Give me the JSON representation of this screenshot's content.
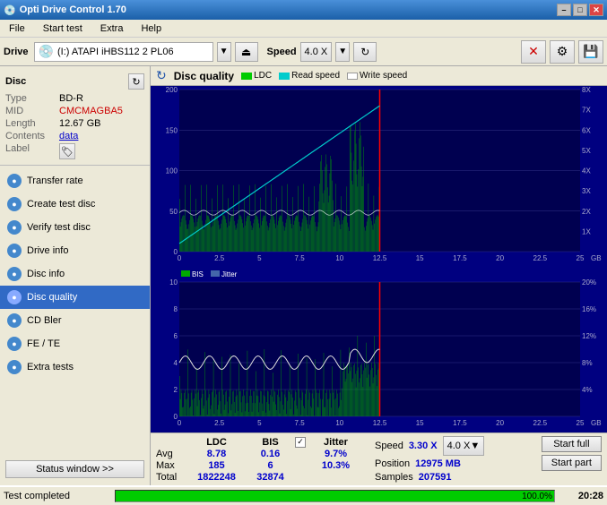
{
  "titlebar": {
    "title": "Opti Drive Control 1.70",
    "icon": "💿",
    "minimize": "–",
    "maximize": "□",
    "close": "✕"
  },
  "menubar": {
    "items": [
      "File",
      "Start test",
      "Extra",
      "Help"
    ]
  },
  "toolbar": {
    "drive_label": "Drive",
    "drive_icon": "💿",
    "drive_value": "(I:)  ATAPI iHBS112  2 PL06",
    "speed_label": "Speed",
    "speed_value": "4.0 X"
  },
  "disc": {
    "title": "Disc",
    "type_label": "Type",
    "type_value": "BD-R",
    "mid_label": "MID",
    "mid_value": "CMCMAGBA5",
    "length_label": "Length",
    "length_value": "12.67 GB",
    "contents_label": "Contents",
    "contents_value": "data",
    "label_label": "Label"
  },
  "sidebar_nav": [
    {
      "id": "transfer-rate",
      "label": "Transfer rate",
      "active": false
    },
    {
      "id": "create-test-disc",
      "label": "Create test disc",
      "active": false
    },
    {
      "id": "verify-test-disc",
      "label": "Verify test disc",
      "active": false
    },
    {
      "id": "drive-info",
      "label": "Drive info",
      "active": false
    },
    {
      "id": "disc-info",
      "label": "Disc info",
      "active": false
    },
    {
      "id": "disc-quality",
      "label": "Disc quality",
      "active": true
    },
    {
      "id": "cd-bler",
      "label": "CD Bler",
      "active": false
    },
    {
      "id": "fe-te",
      "label": "FE / TE",
      "active": false
    },
    {
      "id": "extra-tests",
      "label": "Extra tests",
      "active": false
    }
  ],
  "status_window_btn": "Status window >>",
  "chart": {
    "title": "Disc quality",
    "legend": {
      "ldc_label": "LDC",
      "read_speed_label": "Read speed",
      "write_speed_label": "Write speed",
      "bis_label": "BIS",
      "jitter_label": "Jitter"
    }
  },
  "stats": {
    "columns": {
      "ldc_header": "LDC",
      "bis_header": "BIS",
      "jitter_header": "Jitter",
      "speed_header": "Speed",
      "position_header": "Position",
      "samples_header": "Samples"
    },
    "avg_label": "Avg",
    "max_label": "Max",
    "total_label": "Total",
    "ldc_avg": "8.78",
    "ldc_max": "185",
    "ldc_total": "1822248",
    "bis_avg": "0.16",
    "bis_max": "6",
    "bis_total": "32874",
    "jitter_avg": "9.7%",
    "jitter_max": "10.3%",
    "speed_value": "3.30 X",
    "speed_select": "4.0 X",
    "position_value": "12975 MB",
    "samples_value": "207591",
    "btn_full": "Start full",
    "btn_part": "Start part"
  },
  "statusbar": {
    "text": "Test completed",
    "progress_pct": "100.0%",
    "progress_fill": 100,
    "time": "20:28"
  },
  "colors": {
    "accent_blue": "#316ac5",
    "chart_bg": "#000080",
    "ldc_green": "#00bb00",
    "bis_green": "#00bb00",
    "read_speed_cyan": "#00cccc",
    "write_speed_white": "#ffffff",
    "jitter_white": "#ffffff",
    "progress_green": "#00cc00"
  }
}
